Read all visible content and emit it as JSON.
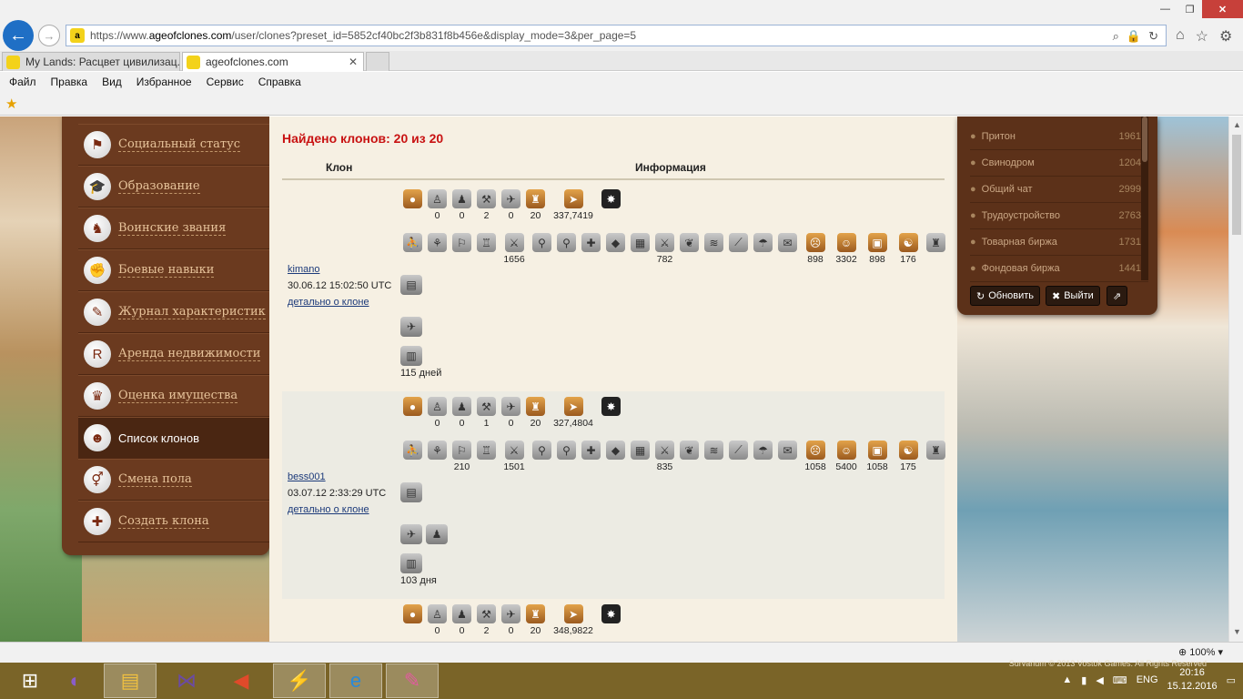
{
  "browser": {
    "url_prefix": "https://www.",
    "url_domain": "ageofclones.com",
    "url_rest": "/user/clones?preset_id=5852cf40bc2f3b831f8b456e&display_mode=3&per_page=5",
    "tabs": [
      {
        "label": "My Lands: Расцвет цивилизац..."
      },
      {
        "label": "ageofclones.com"
      }
    ],
    "menu": [
      "Файл",
      "Правка",
      "Вид",
      "Избранное",
      "Сервис",
      "Справка"
    ],
    "zoom": "100%"
  },
  "sidebar": {
    "items": [
      {
        "label": "Социальный статус",
        "icon": "social-status-icon",
        "glyph": "⚑"
      },
      {
        "label": "Образование",
        "icon": "graduation-cap-icon",
        "glyph": "🎓"
      },
      {
        "label": "Воинские звания",
        "icon": "soldier-icon",
        "glyph": "♞"
      },
      {
        "label": "Боевые навыки",
        "icon": "fist-icon",
        "glyph": "✊"
      },
      {
        "label": "Журнал характеристик",
        "icon": "journal-icon",
        "glyph": "✎"
      },
      {
        "label": "Аренда недвижимости",
        "icon": "rent-icon",
        "glyph": "R"
      },
      {
        "label": "Оценка имущества",
        "icon": "valuation-icon",
        "glyph": "♛"
      },
      {
        "label": "Список клонов",
        "icon": "clones-list-icon",
        "glyph": "☻"
      },
      {
        "label": "Смена пола",
        "icon": "gender-icon",
        "glyph": "⚥"
      },
      {
        "label": "Создать клона",
        "icon": "create-clone-icon",
        "glyph": "✚"
      }
    ]
  },
  "main": {
    "title": "Найдено клонов: 20 из 20",
    "col_clone": "Клон",
    "col_info": "Информация",
    "details_label": "детально о клоне",
    "clones": [
      {
        "name": "kimano",
        "date": "30.06.12 15:02:50 UTC",
        "days": "115 дней",
        "row1": [
          "",
          "0",
          "0",
          "2",
          "0",
          "20",
          "337,7419",
          ""
        ],
        "row2": [
          "",
          "",
          "",
          "",
          "1656",
          "",
          "",
          "",
          "",
          "",
          "782",
          "",
          "",
          "",
          "",
          "",
          "898",
          "3302",
          "898",
          "176",
          ""
        ]
      },
      {
        "name": "bess001",
        "date": "03.07.12 2:33:29 UTC",
        "days": "103 дня",
        "row1": [
          "",
          "0",
          "0",
          "1",
          "0",
          "20",
          "327,4804",
          ""
        ],
        "row2": [
          "",
          "",
          "210",
          "",
          "1501",
          "",
          "",
          "",
          "",
          "",
          "835",
          "",
          "",
          "",
          "",
          "",
          "1058",
          "5400",
          "1058",
          "175",
          ""
        ]
      },
      {
        "row1": [
          "",
          "0",
          "0",
          "2",
          "0",
          "20",
          "348,9822",
          ""
        ]
      }
    ]
  },
  "chat": {
    "rooms": [
      {
        "name": "Притон",
        "count": "1961"
      },
      {
        "name": "Свинодром",
        "count": "1204"
      },
      {
        "name": "Общий чат",
        "count": "2999"
      },
      {
        "name": "Трудоустройство",
        "count": "2763"
      },
      {
        "name": "Товарная биржа",
        "count": "1731"
      },
      {
        "name": "Фондовая биржа",
        "count": "1441"
      }
    ],
    "refresh_label": "Обновить",
    "logout_label": "Выйти"
  },
  "taskbar": {
    "time": "20:16",
    "date": "15.12.2016",
    "lang": "ENG"
  },
  "footer_text": "Survarium © 2013 Vostok Games. All Rights Reserved"
}
